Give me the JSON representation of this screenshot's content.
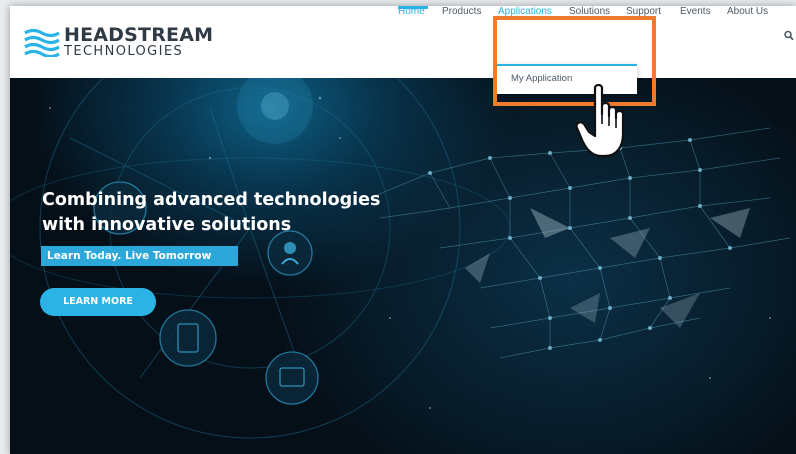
{
  "brand": {
    "name": "HEADSTREAM",
    "subtitle": "TECHNOLOGIES",
    "color": "#2f3a44",
    "wave_color": "#2bb3e6"
  },
  "nav": {
    "items": [
      {
        "label": "Home",
        "active": true
      },
      {
        "label": "Products"
      },
      {
        "label": "Applications",
        "active": true
      },
      {
        "label": "Solutions"
      },
      {
        "label": "Support"
      },
      {
        "label": "Events"
      },
      {
        "label": "About Us"
      }
    ],
    "search_icon": "search-icon"
  },
  "dropdown": {
    "items": [
      "My Application"
    ]
  },
  "hero": {
    "headline_line1": "Combining advanced technologies",
    "headline_line2": "with innovative solutions",
    "tagline": "Learn Today. Live Tomorrow",
    "cta": "LEARN MORE"
  },
  "colors": {
    "accent": "#2bb3e6",
    "highlight": "#ef7c2e",
    "hero_bg": "#071a27"
  },
  "cursor_icon": "hand-pointer-icon"
}
